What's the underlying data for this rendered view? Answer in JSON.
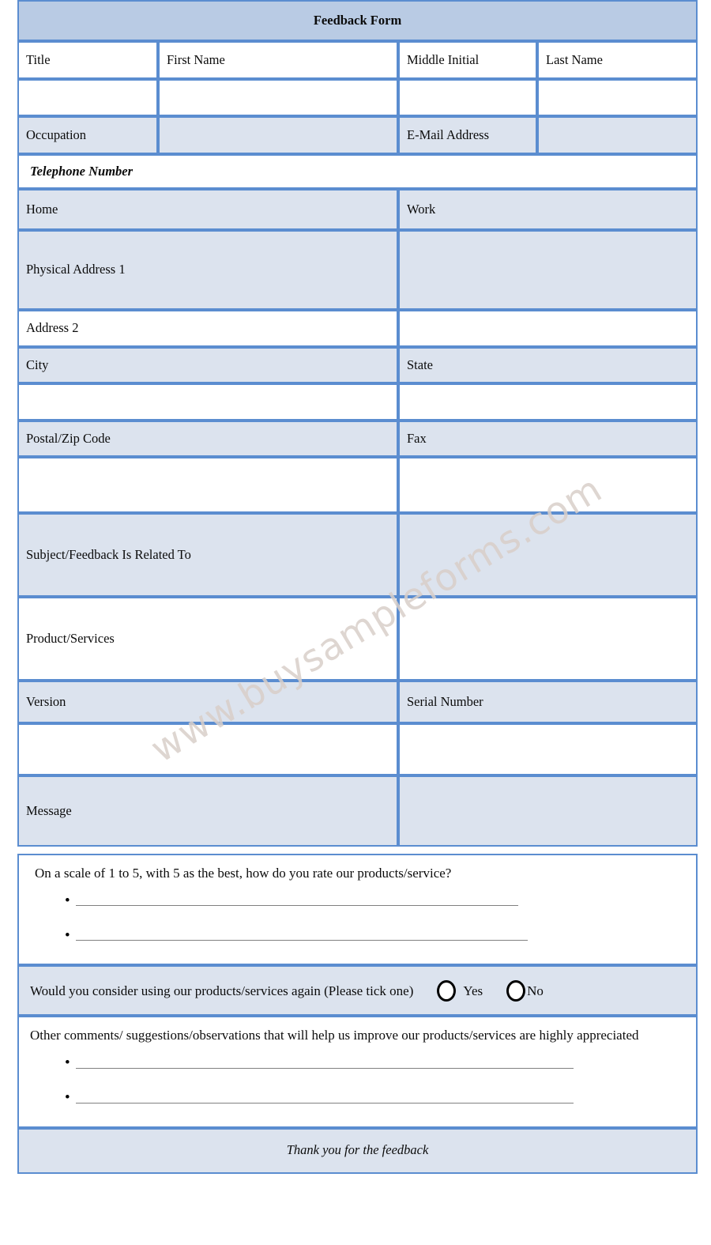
{
  "document": {
    "title": "Feedback Form",
    "watermark": "www.buysampleforms.com"
  },
  "name_section": {
    "labels": {
      "title": "Title",
      "first_name": "First Name",
      "middle_initial": "Middle Initial",
      "last_name": "Last Name"
    },
    "values": {
      "title": "",
      "first_name": "",
      "middle_initial": "",
      "last_name": ""
    }
  },
  "occupation_section": {
    "occupation_label": "Occupation",
    "occupation_value": "",
    "email_label": "E-Mail Address",
    "email_value": ""
  },
  "telephone_section": {
    "heading": "Telephone Number",
    "home_label": "Home",
    "work_label": "Work",
    "home_value": "",
    "work_value": ""
  },
  "address_section": {
    "address1_label": "Physical Address 1",
    "address1_value": "",
    "address2_label": "Address 2",
    "address2_value": "",
    "city_label": "City",
    "state_label": "State",
    "city_value": "",
    "state_value": "",
    "postal_label": "Postal/Zip Code",
    "fax_label": "Fax",
    "postal_value": "",
    "fax_value": ""
  },
  "subject_section": {
    "subject_label": "Subject/Feedback Is Related To",
    "subject_value": "",
    "product_label": "Product/Services",
    "product_value": "",
    "version_label": "Version",
    "serial_label": "Serial Number",
    "version_value": "",
    "serial_value": "",
    "message_label": "Message",
    "message_value": ""
  },
  "rating_question": {
    "text": "On a scale of 1 to 5, with 5 as the best, how do you rate our products/service?",
    "bullet": "•",
    "answer_lines": [
      "",
      ""
    ]
  },
  "reuse_question": {
    "text": "Would you consider using our products/services again (Please tick one)",
    "options": [
      {
        "label": "Yes",
        "selected": false
      },
      {
        "label": "No",
        "selected": false
      }
    ]
  },
  "comments_question": {
    "text": "Other comments/ suggestions/observations that will help us improve our products/services are highly appreciated",
    "bullet": "•",
    "answer_lines": [
      "",
      ""
    ]
  },
  "footer": {
    "text": "Thank you for the feedback"
  },
  "colors": {
    "header_fill": "#b9cbe4",
    "cell_fill": "#dce3ee",
    "border": "#5b8dd0",
    "rule": "#808080",
    "watermark": "#d9cfc9"
  }
}
